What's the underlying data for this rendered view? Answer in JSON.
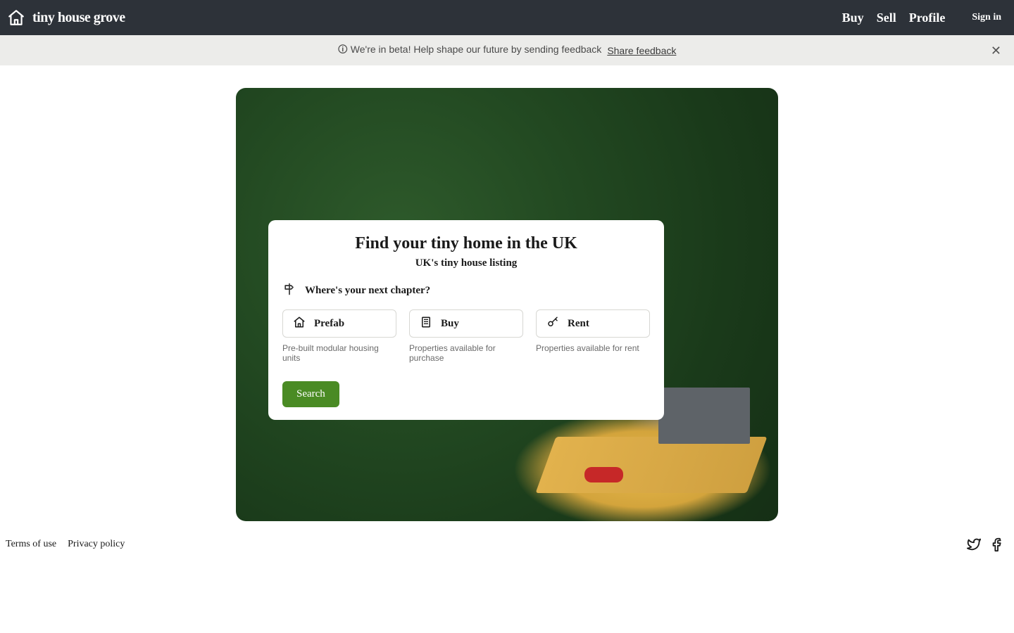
{
  "header": {
    "brand": "tiny house grove",
    "nav": {
      "buy": "Buy",
      "sell": "Sell",
      "profile": "Profile"
    },
    "signin": "Sign in"
  },
  "banner": {
    "text": "🛈 We're in beta! Help shape our future by sending feedback",
    "link": "Share feedback"
  },
  "card": {
    "title": "Find your tiny home in the UK",
    "subtitle": "UK's tiny house listing",
    "chapter": "Where's your next chapter?",
    "options": {
      "prefab": {
        "label": "Prefab",
        "desc": "Pre-built modular housing units"
      },
      "buy": {
        "label": "Buy",
        "desc": "Properties available for purchase"
      },
      "rent": {
        "label": "Rent",
        "desc": "Properties available for rent"
      }
    },
    "search": "Search"
  },
  "footer": {
    "terms": "Terms of use",
    "privacy": "Privacy policy"
  }
}
